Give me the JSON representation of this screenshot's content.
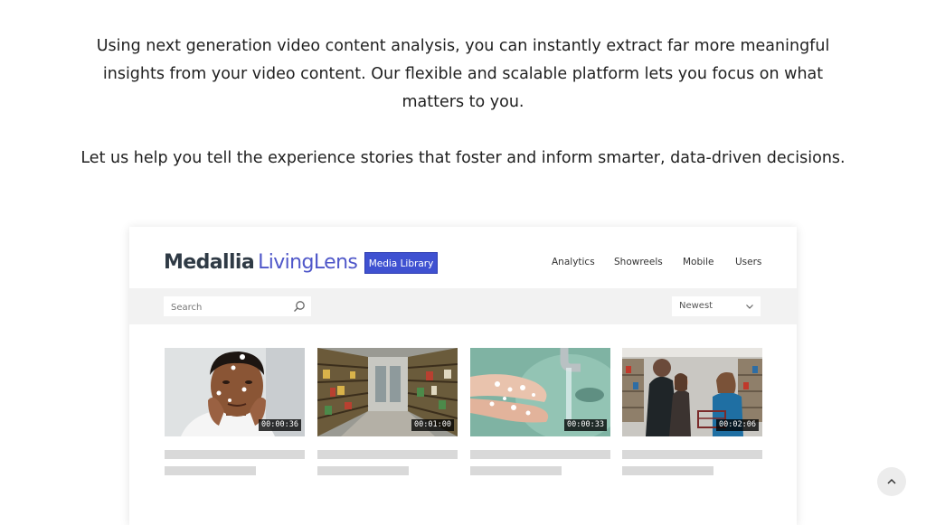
{
  "intro": {
    "paragraph1": "Using next generation video content analysis, you can instantly extract far more meaningful insights from your video content. Our flexible and scalable platform lets you focus on what matters to you.",
    "paragraph2": "Let us help you tell the experience stories that foster and inform smarter, data-driven decisions."
  },
  "app": {
    "brand": "Medallia",
    "product": "LivingLens",
    "active_section": "Media Library",
    "nav": [
      "Analytics",
      "Showreels",
      "Mobile",
      "Users"
    ],
    "search": {
      "placeholder": "Search",
      "value": ""
    },
    "sort": {
      "selected": "Newest"
    },
    "accent_color": "#3f51d1",
    "videos": [
      {
        "thumbnail": "man-applying-face-cream",
        "duration": "00:00:36"
      },
      {
        "thumbnail": "supermarket-aisle",
        "duration": "00:01:00"
      },
      {
        "thumbnail": "hands-washing-under-tap",
        "duration": "00:00:33"
      },
      {
        "thumbnail": "shoppers-in-store",
        "duration": "00:02:06"
      }
    ]
  },
  "page": {
    "scroll_top_icon": "chevron-up-icon"
  }
}
